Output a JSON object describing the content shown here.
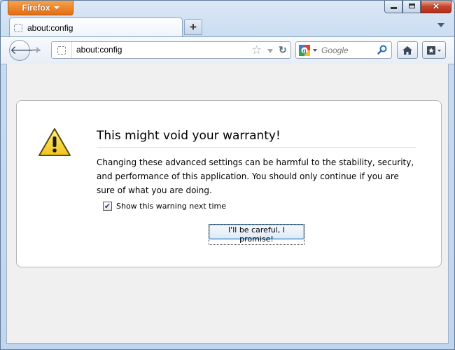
{
  "window": {
    "app_button_label": "Firefox",
    "minimize_icon": "minimize-icon",
    "maximize_icon": "maximize-icon",
    "close_icon": "close-icon",
    "close_glyph": "✕"
  },
  "tabs": [
    {
      "label": "about:config",
      "icon": "page-icon",
      "selected": true
    }
  ],
  "new_tab": {
    "glyph": "+"
  },
  "navbar": {
    "back_glyph": "🡐",
    "forward_glyph": "➜",
    "url": "about:config",
    "star_glyph": "☆",
    "reload_glyph": "↻",
    "search_placeholder": "Google",
    "search_engine_icon": "google-icon"
  },
  "warning": {
    "icon": "warning-icon",
    "title": "This might void your warranty!",
    "message": "Changing these advanced settings can be harmful to the stability, security, and performance of this application. You should only continue if you are sure of what you are doing.",
    "checkbox_label": "Show this warning next time",
    "checkbox_checked": true,
    "checkbox_mark": "✔",
    "button_label": "I'll be careful, I promise!"
  },
  "colors": {
    "firefox_button": "#e36d12",
    "window_frame": "#c7dbf1",
    "content_bg": "#f0f0f0",
    "button_focus": "#3c7fb1"
  }
}
